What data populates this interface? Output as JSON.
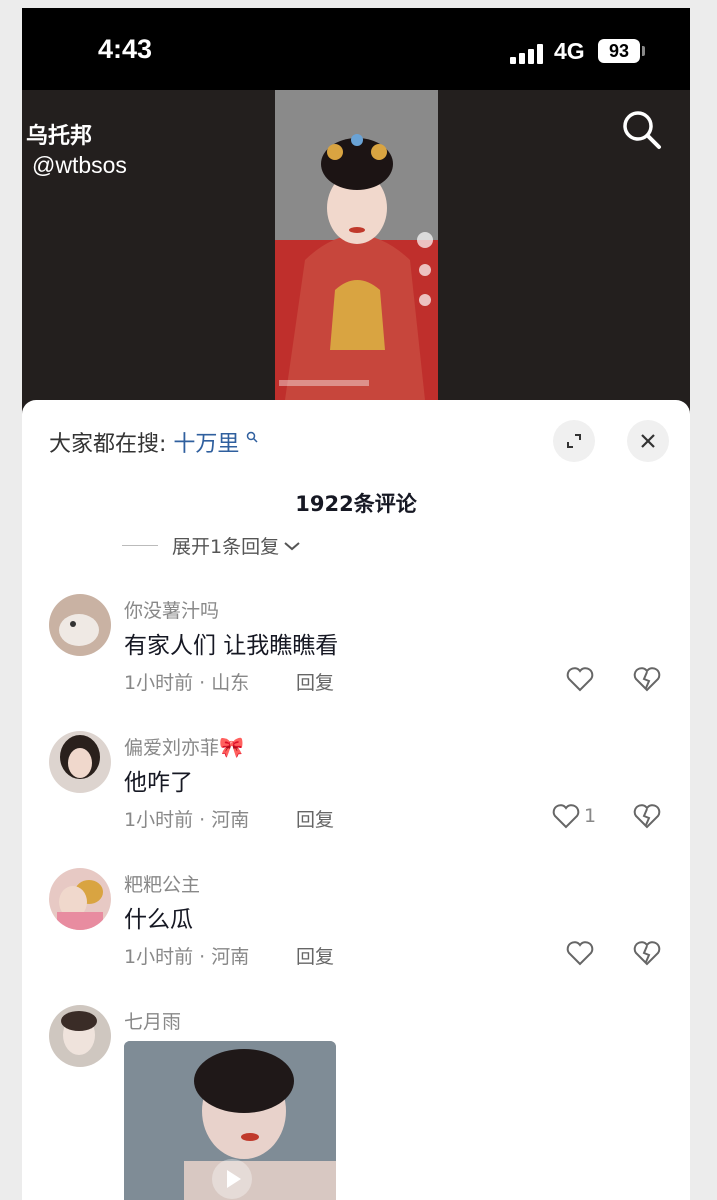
{
  "status_bar": {
    "time": "4:43",
    "network": "4G",
    "battery": "93"
  },
  "watermark": {
    "name": "乌托邦",
    "handle": "@wtbsos"
  },
  "sheet": {
    "hot_search_prefix": "大家都在搜:",
    "hot_search_keyword": "十万里",
    "comments_count": "1922条评论",
    "expand_replies": "展开1条回复"
  },
  "comments": [
    {
      "user": "你没薯汁吗",
      "text": "有家人们 让我瞧瞧看",
      "meta": "1小时前 · 山东",
      "reply": "回复",
      "likes": ""
    },
    {
      "user": "偏爱刘亦菲",
      "text": "他咋了",
      "meta": "1小时前 · 河南",
      "reply": "回复",
      "likes": "1"
    },
    {
      "user": "粑粑公主",
      "text": "什么瓜",
      "meta": "1小时前 · 河南",
      "reply": "回复",
      "likes": ""
    },
    {
      "user": "七月雨",
      "text": "",
      "meta": "",
      "reply": "",
      "likes": ""
    }
  ],
  "icons": {
    "search": "search-icon",
    "expand": "expand-icon",
    "close": "close-icon",
    "like": "heart-icon",
    "dislike": "broken-heart-icon",
    "play": "play-icon",
    "bow": "pink-bow-icon"
  },
  "colors": {
    "accent": "#2f5f9e",
    "muted_text": "#888888",
    "sheet_bg": "#ffffff"
  }
}
